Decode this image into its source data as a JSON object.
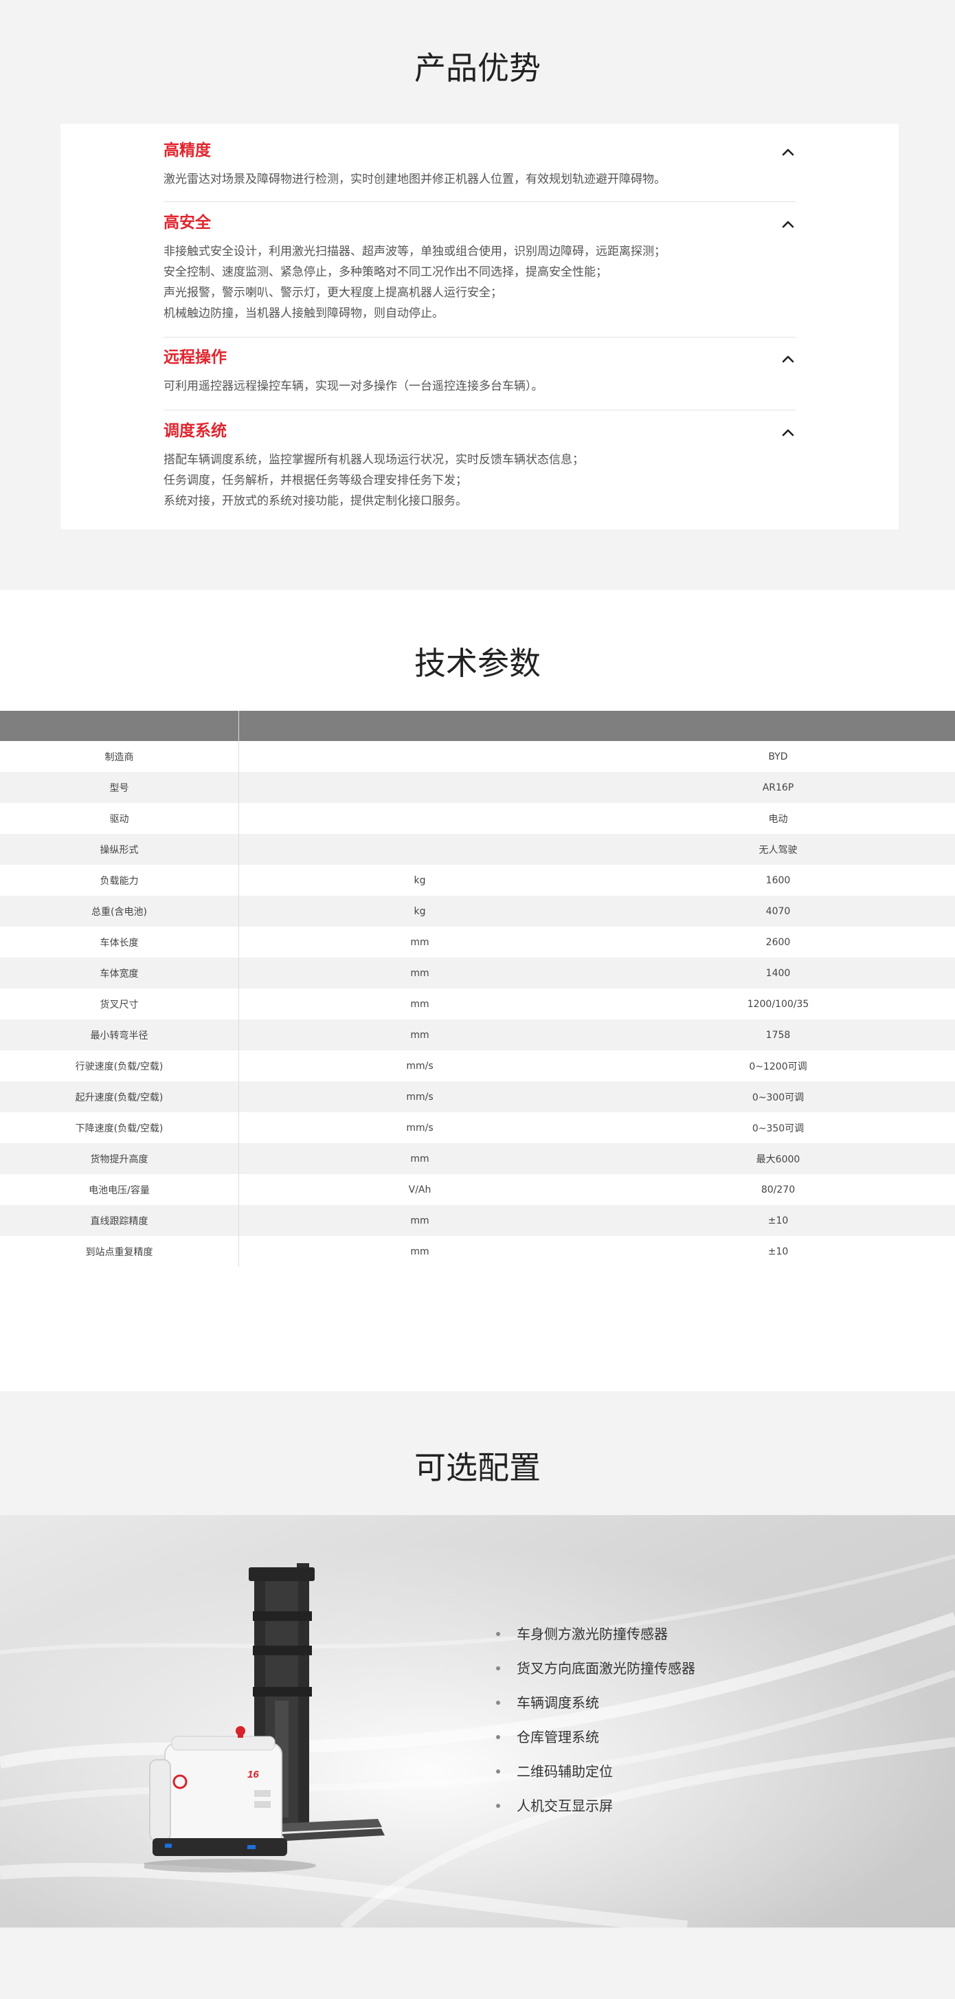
{
  "advantages": {
    "title": "产品优势",
    "items": [
      {
        "heading": "高精度",
        "lines": [
          "激光雷达对场景及障碍物进行检测，实时创建地图并修正机器人位置，有效规划轨迹避开障碍物。"
        ]
      },
      {
        "heading": "高安全",
        "lines": [
          "非接触式安全设计，利用激光扫描器、超声波等，单独或组合使用，识别周边障碍，远距离探测；",
          "安全控制、速度监测、紧急停止，多种策略对不同工况作出不同选择，提高安全性能；",
          "声光报警，警示喇叭、警示灯，更大程度上提高机器人运行安全；",
          "机械触边防撞，当机器人接触到障碍物，则自动停止。"
        ]
      },
      {
        "heading": "远程操作",
        "lines": [
          "可利用遥控器远程操控车辆，实现一对多操作（一台遥控连接多台车辆）。"
        ]
      },
      {
        "heading": "调度系统",
        "lines": [
          "搭配车辆调度系统，监控掌握所有机器人现场运行状况，实时反馈车辆状态信息；",
          "任务调度，任务解析，并根据任务等级合理安排任务下发；",
          "系统对接，开放式的系统对接功能，提供定制化接口服务。"
        ]
      }
    ],
    "toggle_icon": "chevron-up-icon"
  },
  "specs": {
    "title": "技术参数",
    "rows": [
      {
        "name": "制造商",
        "unit": "",
        "value": "BYD"
      },
      {
        "name": "型号",
        "unit": "",
        "value": "AR16P"
      },
      {
        "name": "驱动",
        "unit": "",
        "value": "电动"
      },
      {
        "name": "操纵形式",
        "unit": "",
        "value": "无人驾驶"
      },
      {
        "name": "负载能力",
        "unit": "kg",
        "value": "1600"
      },
      {
        "name": "总重(含电池)",
        "unit": "kg",
        "value": "4070"
      },
      {
        "name": "车体长度",
        "unit": "mm",
        "value": "2600"
      },
      {
        "name": "车体宽度",
        "unit": "mm",
        "value": "1400"
      },
      {
        "name": "货叉尺寸",
        "unit": "mm",
        "value": "1200/100/35"
      },
      {
        "name": "最小转弯半径",
        "unit": "mm",
        "value": "1758"
      },
      {
        "name": "行驶速度(负载/空载)",
        "unit": "mm/s",
        "value": "0~1200可调"
      },
      {
        "name": "起升速度(负载/空载)",
        "unit": "mm/s",
        "value": "0~300可调"
      },
      {
        "name": "下降速度(负载/空载)",
        "unit": "mm/s",
        "value": "0~350可调"
      },
      {
        "name": "货物提升高度",
        "unit": "mm",
        "value": "最大6000"
      },
      {
        "name": "电池电压/容量",
        "unit": "V/Ah",
        "value": "80/270"
      },
      {
        "name": "直线跟踪精度",
        "unit": "mm",
        "value": "±10"
      },
      {
        "name": "到站点重复精度",
        "unit": "mm",
        "value": "±10"
      }
    ]
  },
  "options": {
    "title": "可选配置",
    "items": [
      "车身侧方激光防撞传感器",
      "货叉方向底面激光防撞传感器",
      "车辆调度系统",
      "仓库管理系统",
      "二维码辅助定位",
      "人机交互显示屏"
    ],
    "vehicle_badge": "16"
  },
  "colors": {
    "accent_red": "#e1252e",
    "table_header": "#7f7f7f",
    "page_bg": "#f3f3f3"
  }
}
